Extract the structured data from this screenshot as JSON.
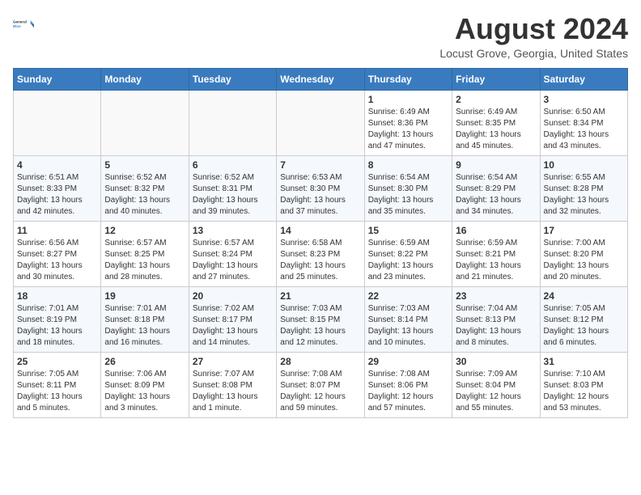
{
  "logo": {
    "general": "General",
    "blue": "Blue"
  },
  "title": "August 2024",
  "subtitle": "Locust Grove, Georgia, United States",
  "days_of_week": [
    "Sunday",
    "Monday",
    "Tuesday",
    "Wednesday",
    "Thursday",
    "Friday",
    "Saturday"
  ],
  "weeks": [
    [
      {
        "day": "",
        "info": ""
      },
      {
        "day": "",
        "info": ""
      },
      {
        "day": "",
        "info": ""
      },
      {
        "day": "",
        "info": ""
      },
      {
        "day": "1",
        "info": "Sunrise: 6:49 AM\nSunset: 8:36 PM\nDaylight: 13 hours\nand 47 minutes."
      },
      {
        "day": "2",
        "info": "Sunrise: 6:49 AM\nSunset: 8:35 PM\nDaylight: 13 hours\nand 45 minutes."
      },
      {
        "day": "3",
        "info": "Sunrise: 6:50 AM\nSunset: 8:34 PM\nDaylight: 13 hours\nand 43 minutes."
      }
    ],
    [
      {
        "day": "4",
        "info": "Sunrise: 6:51 AM\nSunset: 8:33 PM\nDaylight: 13 hours\nand 42 minutes."
      },
      {
        "day": "5",
        "info": "Sunrise: 6:52 AM\nSunset: 8:32 PM\nDaylight: 13 hours\nand 40 minutes."
      },
      {
        "day": "6",
        "info": "Sunrise: 6:52 AM\nSunset: 8:31 PM\nDaylight: 13 hours\nand 39 minutes."
      },
      {
        "day": "7",
        "info": "Sunrise: 6:53 AM\nSunset: 8:30 PM\nDaylight: 13 hours\nand 37 minutes."
      },
      {
        "day": "8",
        "info": "Sunrise: 6:54 AM\nSunset: 8:30 PM\nDaylight: 13 hours\nand 35 minutes."
      },
      {
        "day": "9",
        "info": "Sunrise: 6:54 AM\nSunset: 8:29 PM\nDaylight: 13 hours\nand 34 minutes."
      },
      {
        "day": "10",
        "info": "Sunrise: 6:55 AM\nSunset: 8:28 PM\nDaylight: 13 hours\nand 32 minutes."
      }
    ],
    [
      {
        "day": "11",
        "info": "Sunrise: 6:56 AM\nSunset: 8:27 PM\nDaylight: 13 hours\nand 30 minutes."
      },
      {
        "day": "12",
        "info": "Sunrise: 6:57 AM\nSunset: 8:25 PM\nDaylight: 13 hours\nand 28 minutes."
      },
      {
        "day": "13",
        "info": "Sunrise: 6:57 AM\nSunset: 8:24 PM\nDaylight: 13 hours\nand 27 minutes."
      },
      {
        "day": "14",
        "info": "Sunrise: 6:58 AM\nSunset: 8:23 PM\nDaylight: 13 hours\nand 25 minutes."
      },
      {
        "day": "15",
        "info": "Sunrise: 6:59 AM\nSunset: 8:22 PM\nDaylight: 13 hours\nand 23 minutes."
      },
      {
        "day": "16",
        "info": "Sunrise: 6:59 AM\nSunset: 8:21 PM\nDaylight: 13 hours\nand 21 minutes."
      },
      {
        "day": "17",
        "info": "Sunrise: 7:00 AM\nSunset: 8:20 PM\nDaylight: 13 hours\nand 20 minutes."
      }
    ],
    [
      {
        "day": "18",
        "info": "Sunrise: 7:01 AM\nSunset: 8:19 PM\nDaylight: 13 hours\nand 18 minutes."
      },
      {
        "day": "19",
        "info": "Sunrise: 7:01 AM\nSunset: 8:18 PM\nDaylight: 13 hours\nand 16 minutes."
      },
      {
        "day": "20",
        "info": "Sunrise: 7:02 AM\nSunset: 8:17 PM\nDaylight: 13 hours\nand 14 minutes."
      },
      {
        "day": "21",
        "info": "Sunrise: 7:03 AM\nSunset: 8:15 PM\nDaylight: 13 hours\nand 12 minutes."
      },
      {
        "day": "22",
        "info": "Sunrise: 7:03 AM\nSunset: 8:14 PM\nDaylight: 13 hours\nand 10 minutes."
      },
      {
        "day": "23",
        "info": "Sunrise: 7:04 AM\nSunset: 8:13 PM\nDaylight: 13 hours\nand 8 minutes."
      },
      {
        "day": "24",
        "info": "Sunrise: 7:05 AM\nSunset: 8:12 PM\nDaylight: 13 hours\nand 6 minutes."
      }
    ],
    [
      {
        "day": "25",
        "info": "Sunrise: 7:05 AM\nSunset: 8:11 PM\nDaylight: 13 hours\nand 5 minutes."
      },
      {
        "day": "26",
        "info": "Sunrise: 7:06 AM\nSunset: 8:09 PM\nDaylight: 13 hours\nand 3 minutes."
      },
      {
        "day": "27",
        "info": "Sunrise: 7:07 AM\nSunset: 8:08 PM\nDaylight: 13 hours\nand 1 minute."
      },
      {
        "day": "28",
        "info": "Sunrise: 7:08 AM\nSunset: 8:07 PM\nDaylight: 12 hours\nand 59 minutes."
      },
      {
        "day": "29",
        "info": "Sunrise: 7:08 AM\nSunset: 8:06 PM\nDaylight: 12 hours\nand 57 minutes."
      },
      {
        "day": "30",
        "info": "Sunrise: 7:09 AM\nSunset: 8:04 PM\nDaylight: 12 hours\nand 55 minutes."
      },
      {
        "day": "31",
        "info": "Sunrise: 7:10 AM\nSunset: 8:03 PM\nDaylight: 12 hours\nand 53 minutes."
      }
    ]
  ]
}
